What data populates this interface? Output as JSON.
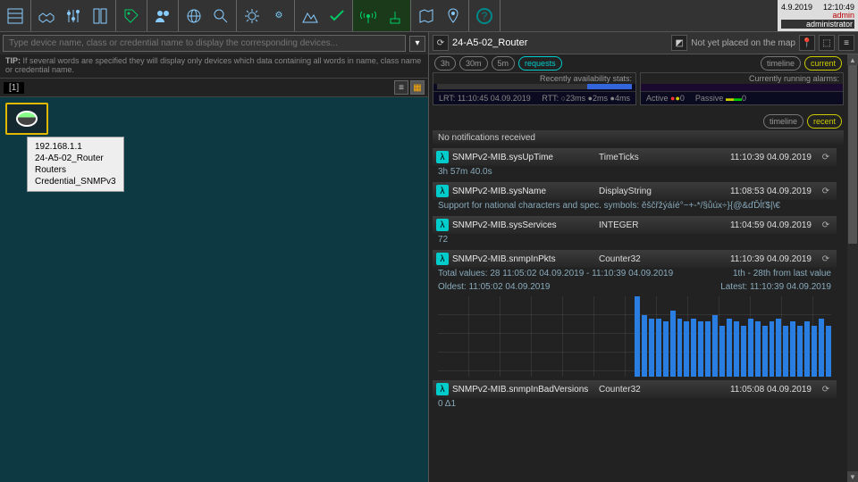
{
  "header": {
    "date": "4.9.2019",
    "time": "12:10:49",
    "role": "admin",
    "user": "administrator"
  },
  "search": {
    "placeholder": "Type device name, class or credential name to display the corresponding devices...",
    "tip_label": "TIP:",
    "tip_text": "If several words are specified they will display only devices which data containing all words in name, class name or credential name."
  },
  "grid": {
    "count_label": "[1]",
    "tooltip_lines": "192.168.1.1\n24-A5-02_Router\nRouters\nCredential_SNMPv3"
  },
  "device": {
    "title": "24-A5-02_Router",
    "map_status": "Not yet placed on the map"
  },
  "time_pills": {
    "h3": "3h",
    "m30": "30m",
    "m5": "5m",
    "requests": "requests"
  },
  "view_pills": {
    "timeline": "timeline",
    "current": "current",
    "recent": "recent"
  },
  "avail": {
    "title": "Recently availability stats:",
    "lrt": "LRT: 11:10:45 04.09.2019",
    "rtt": "RTT: ○23ms ●2ms ●4ms"
  },
  "alarms": {
    "title": "Currently running alarms:",
    "active_label": "Active",
    "active_val": "0",
    "passive_label": "Passive",
    "passive_val": "0"
  },
  "notifications": {
    "none": "No notifications received"
  },
  "metrics": [
    {
      "name": "SNMPv2-MIB.sysUpTime",
      "type": "TimeTicks",
      "time": "11:10:39 04.09.2019",
      "sub_left": "3h 57m 40.0s",
      "sub_right": ""
    },
    {
      "name": "SNMPv2-MIB.sysName",
      "type": "DisplayString",
      "time": "11:08:53 04.09.2019",
      "sub_left": "Support for national characters and spec. symbols: ěščřžýáíé°~+-*/§ůúx÷}{@&ďĎĺť$|\\€",
      "sub_right": ""
    },
    {
      "name": "SNMPv2-MIB.sysServices",
      "type": "INTEGER",
      "time": "11:04:59 04.09.2019",
      "sub_left": "72",
      "sub_right": ""
    },
    {
      "name": "SNMPv2-MIB.snmpInPkts",
      "type": "Counter32",
      "time": "11:10:39 04.09.2019",
      "sub_left": "Total values: 28              11:05:02 04.09.2019 - 11:10:39 04.09.2019",
      "sub_right": "1th - 28th from last value",
      "sub2_left": "Oldest: 11:05:02 04.09.2019",
      "sub2_right": "Latest: 11:10:39 04.09.2019",
      "chart": true
    },
    {
      "name": "SNMPv2-MIB.snmpInBadVersions",
      "type": "Counter32",
      "time": "11:05:08 04.09.2019",
      "sub_left": "0 Δ1",
      "sub_right": ""
    }
  ],
  "chart_data": {
    "type": "bar",
    "title": "SNMPv2-MIB.snmpInPkts",
    "xlabel": "",
    "ylabel": "",
    "values": [
      55,
      42,
      40,
      40,
      38,
      45,
      40,
      38,
      40,
      38,
      38,
      42,
      35,
      40,
      38,
      35,
      40,
      38,
      35,
      38,
      40,
      35,
      38,
      35,
      38,
      35,
      40,
      35
    ],
    "ylim": [
      0,
      60
    ]
  }
}
